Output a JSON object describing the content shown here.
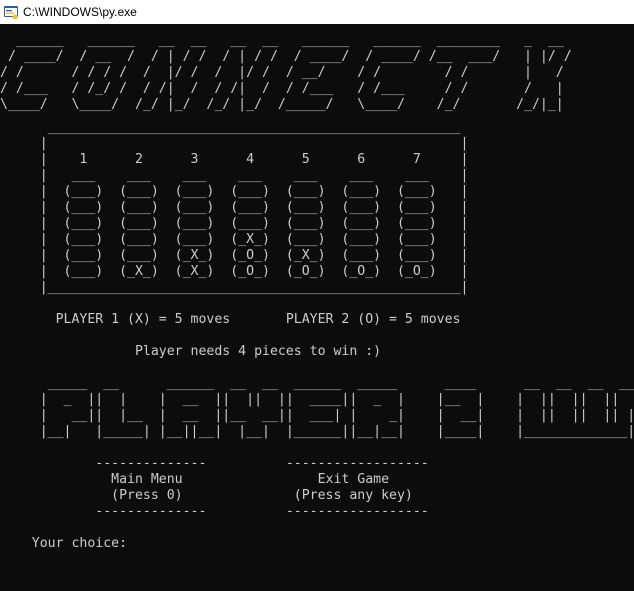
{
  "window": {
    "title": "C:\\WINDOWS\\py.exe",
    "icon": "python-launcher-icon"
  },
  "console": {
    "fg_color": "#cccccc",
    "bg_color": "#0c0c0c",
    "logo_lines": [
      "  ______   ______   __  __   __  __   ______   ______  ________   _  __",
      " / ____/  / __  /  / | / /  / | / /  / ____/  / ____/ /__  ___/   | |/ /",
      "/ /      / / / /  /  |/ /  /  |/ /  / __/    / /        / /       |   / ",
      "/ /___   / /_/ /  / /|  /  / /|  /  / /___   / /___     / /       /   |  ",
      "\\____/   \\____/  /_/ |_/  /_/ |_/  /_____/   \\____/    /_/       /_/|_|  "
    ],
    "board_lines": [
      "      ____________________________________________________",
      "     |                                                    |",
      "     |    1      2      3      4      5      6      7     |",
      "     |   ___    ___    ___    ___    ___    ___    ___    |",
      "     |  (___)  (___)  (___)  (___)  (___)  (___)  (___)   |",
      "     |  (___)  (___)  (___)  (___)  (___)  (___)  (___)   |",
      "     |  (___)  (___)  (___)  (___)  (___)  (___)  (___)   |",
      "     |  (___)  (___)  (___)  (_X_)  (___)  (___)  (___)   |",
      "     |  (___)  (___)  (_X_)  (_O_)  (_X_)  (___)  (___)   |",
      "     |  (___)  (_X_)  (_X_)  (_O_)  (_O_)  (_O_)  (_O_)   |",
      "     |____________________________________________________|"
    ],
    "players_line": "       PLAYER 1 (X) = 5 moves       PLAYER 2 (O) = 5 moves",
    "win_rule_line": "                 Player needs 4 pieces to win :)",
    "banner_lines": [
      "      _____  __      ______  __  __  ______  _____      ____      __  __  __  ______  _____   __",
      "     |  _  ||  |    |  __  ||  ||  ||  ____||  _  |    |__  |    |  ||  ||  ||  __  ||     | |  |",
      "     |   __||  |__  |  __  ||__  __||  ___| |    _|    |  __|    |  ||  ||  || |__| ||  |  | |__|",
      "     |__|   |_____| |__||__|  |__|  |______||__|__|    |____|    |_____________||______||__|__| |__|"
    ],
    "menu_lines": [
      "            --------------          ------------------",
      "              Main Menu                 Exit Game",
      "              (Press 0)              (Press any key)",
      "            --------------          ------------------"
    ],
    "prompt_line": "    Your choice: "
  }
}
